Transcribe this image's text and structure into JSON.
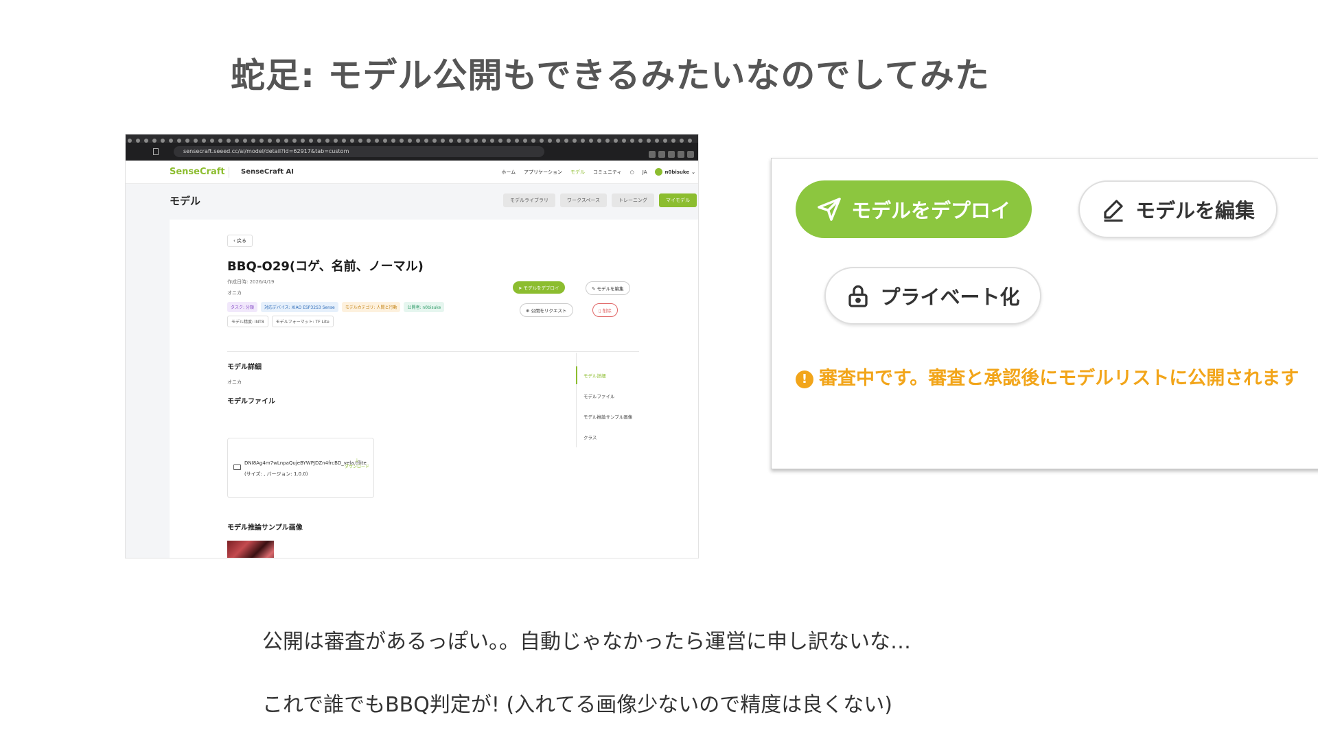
{
  "slide": {
    "title": "蛇足: モデル公開もできるみたいなのでしてみた",
    "captions": [
      "公開は審査があるっぽい。。自動じゃなかったら運営に申し訳ないな…",
      "これで誰でもBBQ判定が! (入れてる画像少ないので精度は良くない)"
    ]
  },
  "browser": {
    "url": "sensecraft.seeed.cc/ai/model/detail?id=62917&tab=custom"
  },
  "app": {
    "logo_a": "Sense",
    "logo_b": "Craft",
    "name": "SenseCraft AI",
    "nav": [
      "ホーム",
      "アプリケーション",
      "モデル",
      "コミュニティ",
      "JA"
    ],
    "user": "n0bisuke",
    "page_title": "モデル",
    "page_tabs": [
      "モデルライブラリ",
      "ワークスペース",
      "トレーニング",
      "マイモデル"
    ]
  },
  "model": {
    "back": "戻る",
    "title": "BBQ-O29(コゲ、名前、ノーマル)",
    "created": "作成日時: 2026/4/19",
    "author": "オニカ",
    "tags": [
      "タスク: 分類",
      "対応デバイス: XIAO ESP32S3 Sense",
      "モデルカテゴリ: 人間と行動",
      "公開者: n0bisuke",
      "モデル精度: INT8",
      "モデルフォーマット: TF Lite"
    ],
    "buttons": {
      "deploy": "モデルをデプロイ",
      "edit": "モデルを編集",
      "request_public": "公開をリクエスト",
      "delete": "削除"
    },
    "sections": {
      "detail": "モデル詳細",
      "detail_text": "オニカ",
      "files": "モデルファイル",
      "samples": "モデル推論サンプル画像"
    },
    "file": {
      "name": "DNI8Ag4m7wLnpaQujeBYWPJDZn4frcBD_vela.tflite (サイズ: , バージョン: 1.0.0)",
      "download": "ダウンロード"
    },
    "toc": [
      "モデル詳細",
      "モデルファイル",
      "モデル推論サンプル画像",
      "クラス"
    ]
  },
  "zoom": {
    "deploy": "モデルをデプロイ",
    "edit": "モデルを編集",
    "private": "プライベート化",
    "notice": "審査中です。審査と承認後にモデルリストに公開されます",
    "notice_icon": "!"
  },
  "colors": {
    "brand_green": "#8cc63f",
    "notice_orange": "#f2a51a"
  },
  "icons": [
    "send-icon",
    "pencil-icon",
    "lock-icon",
    "info-icon",
    "folder-icon",
    "download-icon"
  ]
}
